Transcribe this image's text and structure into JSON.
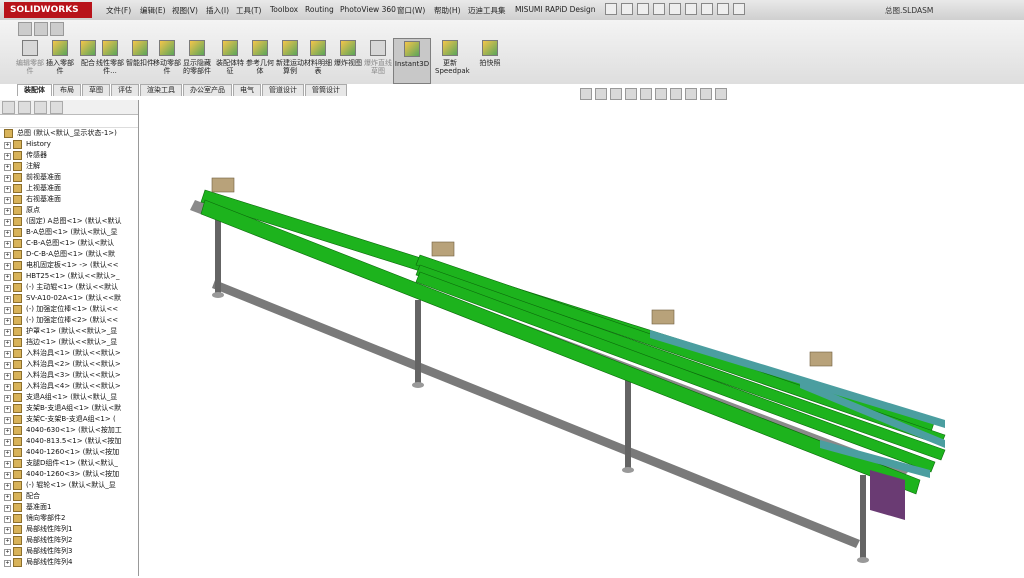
{
  "app": {
    "logo": "SOLIDWORKS",
    "document_title": "总图.SLDASM"
  },
  "menu": [
    "文件(F)",
    "编辑(E)",
    "视图(V)",
    "插入(I)",
    "工具(T)",
    "Toolbox",
    "Routing",
    "PhotoView 360",
    "窗口(W)",
    "帮助(H)",
    "迈迪工具集",
    "MISUMI RAPiD Design"
  ],
  "ribbon": [
    {
      "label": "编辑零部件",
      "enabled": false
    },
    {
      "label": "插入零部件",
      "enabled": true
    },
    {
      "label": "配合",
      "enabled": true
    },
    {
      "label": "线性零部件...",
      "enabled": true
    },
    {
      "label": "智能扣件",
      "enabled": true
    },
    {
      "label": "移动零部件",
      "enabled": true
    },
    {
      "label": "显示隐藏的零部件",
      "enabled": true
    },
    {
      "label": "装配体特征",
      "enabled": true
    },
    {
      "label": "参考几何体",
      "enabled": true
    },
    {
      "label": "新建运动算例",
      "enabled": true
    },
    {
      "label": "材料明细表",
      "enabled": true
    },
    {
      "label": "爆炸视图",
      "enabled": true
    },
    {
      "label": "爆炸直线草图",
      "enabled": false
    },
    {
      "label": "Instant3D",
      "enabled": true,
      "selected": true
    },
    {
      "label": "更新Speedpak",
      "enabled": true
    },
    {
      "label": "拍快照",
      "enabled": true
    }
  ],
  "tabs": [
    "装配体",
    "布局",
    "草图",
    "评估",
    "渲染工具",
    "办公室产品",
    "电气",
    "管道设计",
    "管筒设计"
  ],
  "tree": {
    "root": "总图  (默认<默认_显示状态-1>)",
    "items": [
      "History",
      "传感器",
      "注解",
      "前视基准面",
      "上视基准面",
      "右视基准面",
      "原点",
      "(固定) A总图<1> (默认<默认",
      "B-A总图<1> (默认<默认_显",
      "C-B-A总图<1> (默认<默认",
      "D-C-B-A总图<1> (默认<默",
      "电机固定板<1> -> (默认<<",
      "HBT25<1> (默认<<默认>_",
      "(-) 主动辊<1> (默认<<默认",
      "SV-A10-02A<1> (默认<<默",
      "(-) 加强定位棒<1> (默认<<",
      "(-) 加强定位棒<2> (默认<<",
      "护罩<1> (默认<<默认>_显",
      "挡边<1> (默认<<默认>_显",
      "入料治具<1> (默认<<默认>",
      "入料治具<2> (默认<<默认>",
      "入料治具<3> (默认<<默认>",
      "入料治具<4> (默认<<默认>",
      "支退A组<1> (默认<默认_显",
      "支架B-支退A组<1> (默认<默",
      "支架C-支架B-支退A组<1> (",
      "4040-630<1> (默认<按加工",
      "4040-813.5<1> (默认<按加",
      "4040-1260<1> (默认<按加",
      "支腿D组件<1> (默认<默认_",
      "4040-1260<3> (默认<按加",
      "(-) 辊轮<1> (默认<默认_显",
      "配合",
      "基准面1",
      "镜向零部件2",
      "局部线性阵列1",
      "局部线性阵列2",
      "局部线性阵列3",
      "局部线性阵列4"
    ]
  },
  "colors": {
    "belt": "#1db31d",
    "frame": "#646464",
    "plate": "#6a3b73",
    "guide": "#4b9ea0"
  }
}
